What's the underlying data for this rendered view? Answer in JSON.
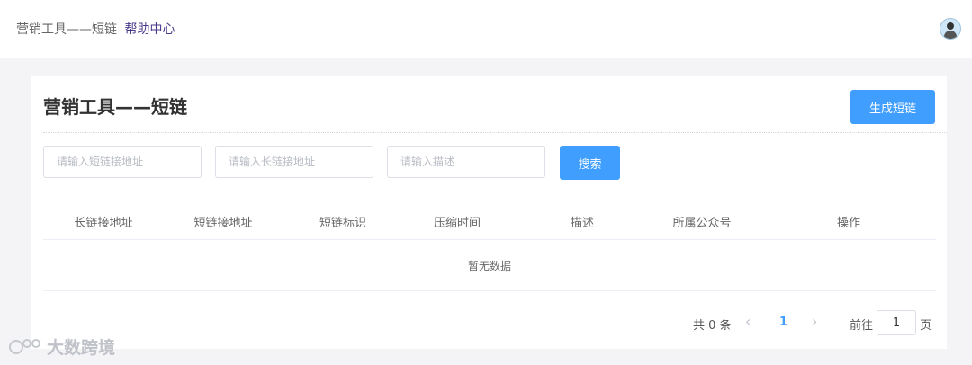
{
  "header": {
    "breadcrumb": "营销工具——短链",
    "help_link": "帮助中心"
  },
  "card": {
    "title": "营销工具——短链",
    "generate_button": "生成短链"
  },
  "filters": {
    "short_url_placeholder": "请输入短链接地址",
    "long_url_placeholder": "请输入长链接地址",
    "description_placeholder": "请输入描述",
    "search_button": "搜索"
  },
  "table": {
    "columns": [
      "长链接地址",
      "短链接地址",
      "短链标识",
      "压缩时间",
      "描述",
      "所属公众号",
      "操作"
    ],
    "empty_text": "暂无数据"
  },
  "pagination": {
    "total_text": "共 0 条",
    "prev_symbol": "‹",
    "current_page": "1",
    "next_symbol": "›",
    "goto_label": "前往",
    "jump_value": "1",
    "page_suffix": "页"
  },
  "watermark": {
    "text": "大数跨境",
    "icon": "ice-cream-logo-icon"
  }
}
